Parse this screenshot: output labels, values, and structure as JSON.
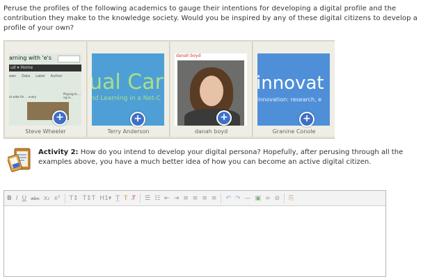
{
  "intro": "Peruse the profiles of the following academics to gauge their intentions for developing a digital profile and the contribution they make to the knowledge society. Would you be inspired by any of these digital citizens to develop a profile of your own?",
  "profiles": [
    {
      "name": "Steve Wheeler",
      "thumb_title": "arning with 'e's",
      "nav_text": "ud ▾  Home",
      "menu": [
        "awn",
        "Data",
        "Label",
        "Author"
      ],
      "sidebar_text": "ut wide for ... every",
      "right_text": "Playing to ... ng in..."
    },
    {
      "name": "Terry Anderson",
      "big_text": "ual Car",
      "small_text": "nd Learning in a Net-C"
    },
    {
      "name": "danah boyd",
      "header_text": "danah boyd"
    },
    {
      "name": "Granine Conole",
      "big_text": "innovat",
      "small_text": "innovation: research, e"
    }
  ],
  "add_symbol": "+",
  "activity": {
    "label": "Activity 2:",
    "text": " How do you intend to develop your digital persona? Hopefully, after perusing through all the examples above, you have a much better idea of how you can become an active digital citizen."
  },
  "toolbar": {
    "bold": "B",
    "italic": "I",
    "underline": "U",
    "strike": "abc",
    "subscript": "x₂",
    "superscript": "x²",
    "font_size": "T↕",
    "font_family": "T↕T",
    "heading": "H1▾",
    "format": "T̲",
    "clear": "T̸",
    "undo": "↶",
    "redo": "↷"
  },
  "colors": {
    "accent": "#3e6fc6",
    "gallery_bg": "#e2e0d4"
  }
}
